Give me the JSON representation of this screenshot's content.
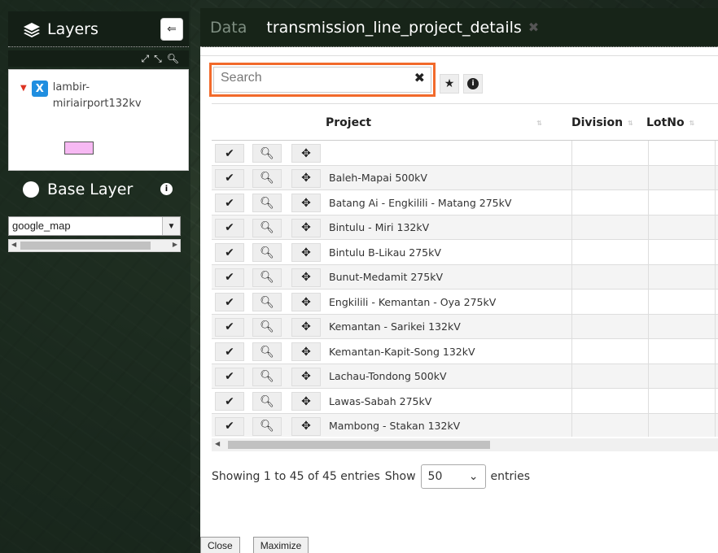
{
  "layers_panel": {
    "title": "Layers",
    "collapse_icon": "arrow-left-box-icon",
    "tools": [
      "expand-icon",
      "collapse-arrows-icon",
      "zoom-icon"
    ],
    "layer": {
      "badge": "X",
      "name": "lambir-miriairport132kv",
      "swatch_color": "#f7b9f3"
    }
  },
  "base_layer": {
    "title": "Base Layer",
    "selected": "google_map"
  },
  "tabs": {
    "data": "Data",
    "active": "transmission_line_project_details"
  },
  "search": {
    "placeholder": "Search"
  },
  "table": {
    "columns": {
      "project": "Project",
      "division": "Division",
      "lotno": "LotNo"
    },
    "rows": [
      "",
      "Baleh-Mapai 500kV",
      "Batang Ai - Engkilili - Matang 275kV",
      "Bintulu - Miri 132kV",
      "Bintulu B-Likau 275kV",
      "Bunut-Medamit 275kV",
      "Engkilili - Kemantan - Oya 275kV",
      "Kemantan - Sarikei 132kV",
      "Kemantan-Kapit-Song 132kV",
      "Lachau-Tondong 500kV",
      "Lawas-Sabah 275kV",
      "Mambong - Stakan 132kV"
    ]
  },
  "footer": {
    "info": "Showing 1 to 45 of 45 entries",
    "show": "Show",
    "length": "50",
    "entries": "entries"
  },
  "buttons": {
    "close": "Close",
    "maximize": "Maximize"
  },
  "colors": {
    "highlight": "#f26a2b",
    "badge": "#1f8ee0"
  }
}
